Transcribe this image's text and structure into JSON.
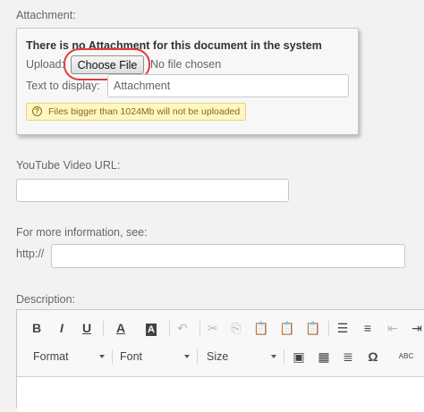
{
  "attachment": {
    "label": "Attachment:",
    "no_attachment_text": "There is no Attachment for this document in the system",
    "upload_label": "Upload:",
    "choose_file_label": "Choose File",
    "no_file_text": "No file chosen",
    "text_display_label": "Text to display:",
    "text_display_value": "Attachment",
    "warning": "Files bigger than 1024Mb will not be uploaded"
  },
  "youtube": {
    "label": "YouTube Video URL:",
    "value": ""
  },
  "more_info": {
    "label": "For more information, see:",
    "prefix": "http://",
    "value": ""
  },
  "description": {
    "label": "Description:",
    "toolbar": {
      "bold": "B",
      "italic": "I",
      "underline": "U",
      "text_color": "A",
      "bg_color": "A",
      "format": "Format",
      "font": "Font",
      "size": "Size",
      "special_char": "Ω",
      "spell": "ABC"
    }
  },
  "colors": {
    "highlight_ring": "#e23b3b",
    "warning_bg": "#fcf7c5"
  }
}
